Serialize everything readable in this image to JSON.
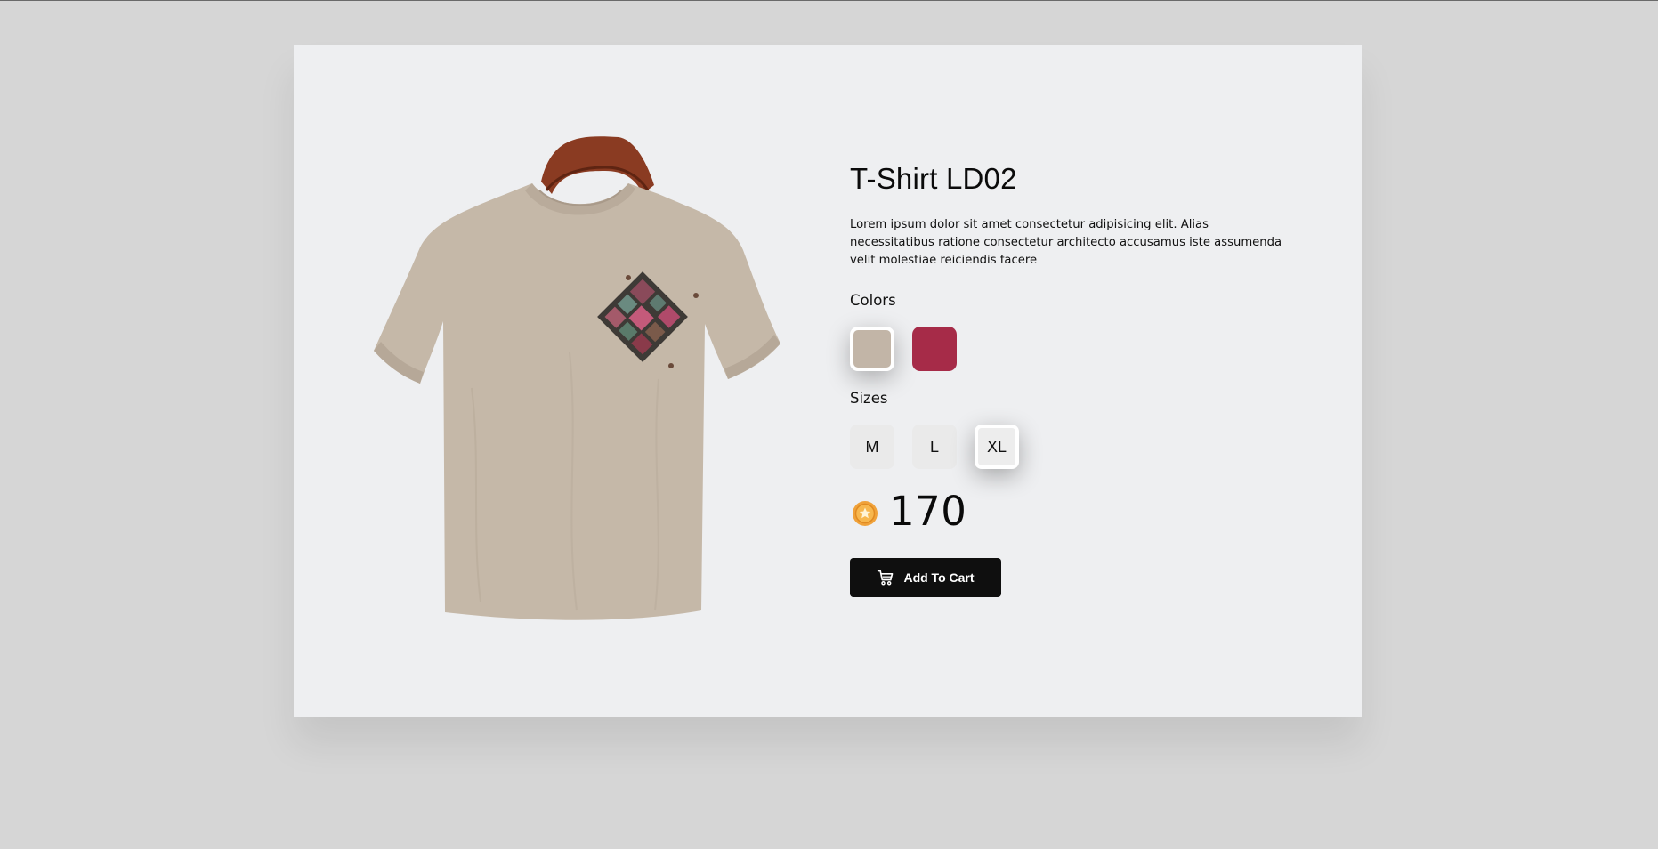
{
  "product": {
    "title": "T-Shirt LD02",
    "description": "Lorem ipsum dolor sit amet consectetur adipisicing elit. Alias necessitatibus ratione consectetur architecto accusamus iste assumenda velit molestiae reiciendis facere",
    "image_icon": "tshirt-image"
  },
  "colors": {
    "label": "Colors",
    "options": [
      {
        "name": "beige",
        "hex": "#c2b5a7",
        "selected": true
      },
      {
        "name": "crimson",
        "hex": "#a62b48",
        "selected": false
      }
    ]
  },
  "sizes": {
    "label": "Sizes",
    "options": [
      {
        "label": "M",
        "selected": false
      },
      {
        "label": "L",
        "selected": false
      },
      {
        "label": "XL",
        "selected": true
      }
    ]
  },
  "price": {
    "value": "170",
    "icon": "coin-icon"
  },
  "cart": {
    "label": "Add To Cart",
    "icon": "cart-icon"
  },
  "theme": {
    "page_bg": "#d6d6d6",
    "card_bg": "#eeeff1",
    "button_bg": "#0f0f0f"
  }
}
